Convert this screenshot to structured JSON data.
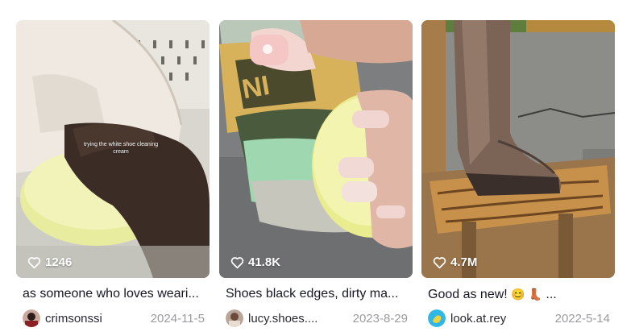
{
  "videos": [
    {
      "likes": "1246",
      "overlay_text": "trying the white shoe cleaning cream",
      "caption": "as someone who loves weari...",
      "username": "crimsonssi",
      "date": "2024-11-5"
    },
    {
      "likes": "41.8K",
      "caption": "Shoes black edges, dirty ma...",
      "username": "lucy.shoes....",
      "date": "2023-8-29"
    },
    {
      "likes": "4.7M",
      "caption": "Good as new!",
      "caption_emojis": "😊 👢",
      "caption_suffix": "...",
      "username": "look.at.rey",
      "date": "2022-5-14"
    }
  ],
  "icons": {
    "like": "heart-outline-icon"
  }
}
